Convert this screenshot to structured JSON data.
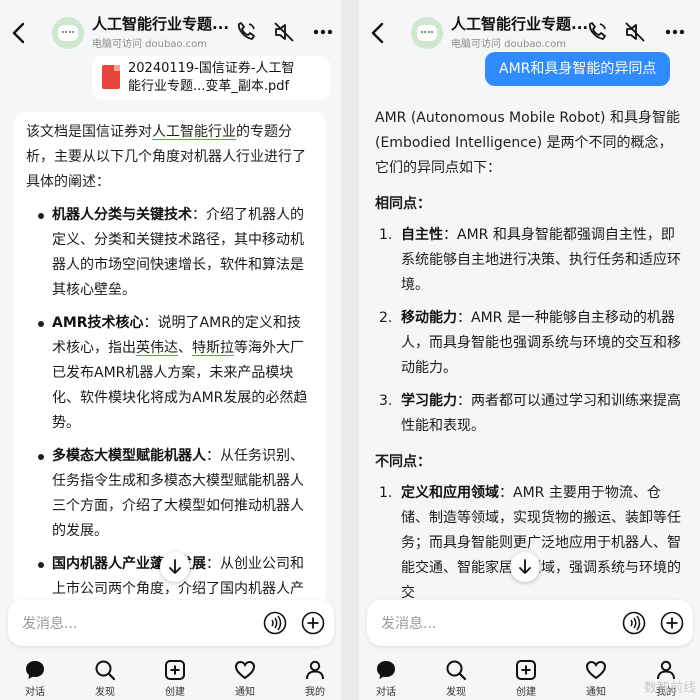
{
  "left": {
    "header": {
      "title": "人工智能行业专题...",
      "subtitle": "电脑可访问 doubao.com"
    },
    "file": {
      "line1": "20240119-国信证券-人工智",
      "line2": "能行业专题...变革_副本.pdf"
    },
    "intro": {
      "pre": "该文档是国信证券对",
      "link": "人工智能行业",
      "post": "的专题分析，主要从以下几个角度对机器人行业进行了具体的阐述："
    },
    "bullets": [
      {
        "title": "机器人分类与关键技术",
        "text": "：介绍了机器人的定义、分类和关键技术路径，其中移动机器人的市场空间快速增长，软件和算法是其核心壁垒。"
      },
      {
        "title": "AMR技术核心",
        "text_pre": "：说明了AMR的定义和技术核心，指出",
        "link1": "英伟达",
        "sep": "、",
        "link2": "特斯拉",
        "text_post": "等海外大厂已发布AMR机器人方案，未来产品模块化、软件模块化将成为AMR发展的必然趋势。"
      },
      {
        "title": "多模态大模型赋能机器人",
        "text": "：从任务识别、任务指令生成和多模态大模型赋能机器人三个方面，介绍了大模型如何推动机器人的发展。"
      },
      {
        "title": "国内机器人产业蓬勃发展",
        "text": "：从创业公司和上市公司两个角度，介绍了国内机器人产业的发展情况。海康机器"
      }
    ]
  },
  "right": {
    "header": {
      "title": "人工智能行业专题...",
      "subtitle": "电脑可访问 doubao.com"
    },
    "user_message": "AMR和具身智能的异同点",
    "intro": "AMR (Autonomous Mobile Robot) 和具身智能 (Embodied Intelligence) 是两个不同的概念，它们的异同点如下：",
    "same_heading": "相同点：",
    "same": [
      {
        "num": "1.",
        "title": "自主性",
        "text": "：AMR 和具身智能都强调自主性，即系统能够自主地进行决策、执行任务和适应环境。"
      },
      {
        "num": "2.",
        "title": "移动能力",
        "text": "：AMR 是一种能够自主移动的机器人，而具身智能也强调系统与环境的交互和移动能力。"
      },
      {
        "num": "3.",
        "title": "学习能力",
        "text": "：两者都可以通过学习和训练来提高性能和表现。"
      }
    ],
    "diff_heading": "不同点：",
    "diff": [
      {
        "num": "1.",
        "title": "定义和应用领域",
        "text": "：AMR 主要用于物流、仓储、制造等领域，实现货物的搬运、装卸等任务；而具身智能则更广泛地应用于机器人、智能交通、智能家居等领域，强调系统与环境的交"
      }
    ],
    "watermark": "数智前线"
  },
  "input": {
    "placeholder": "发消息..."
  },
  "tabs": [
    {
      "label": "对话",
      "icon": "chat-bubble-icon"
    },
    {
      "label": "发现",
      "icon": "search-icon"
    },
    {
      "label": "创建",
      "icon": "plus-square-icon"
    },
    {
      "label": "通知",
      "icon": "heart-icon"
    },
    {
      "label": "我的",
      "icon": "person-icon"
    }
  ],
  "colors": {
    "accent": "#2f8bff",
    "pdf": "#e8453c",
    "avatar_bg": "#cfe6cf"
  }
}
